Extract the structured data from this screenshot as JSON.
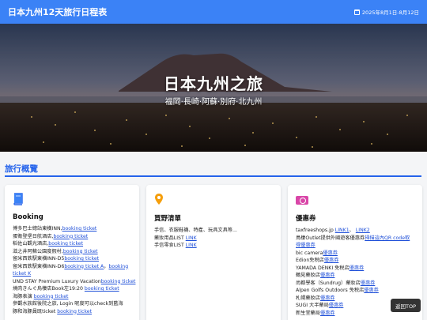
{
  "header": {
    "title": "日本九州12天旅行日程表",
    "date_range": "2025年8月1日-8月12日",
    "calendar_icon": "calendar-icon"
  },
  "hero": {
    "title": "日本九州之旅",
    "subtitle": "福岡·長崎·阿蘇·別府·北九州"
  },
  "section": {
    "title": "旅行概覽"
  },
  "cards": {
    "booking": {
      "icon": "book-icon",
      "title": "Booking",
      "lines": [
        {
          "text": "博多巴士總站東橫INN,",
          "link": "booking ticket",
          "tail": ""
        },
        {
          "text": "蛋衛登堡日航酒店,",
          "link": "booking ticket",
          "tail": ""
        },
        {
          "text": "稻佐山觀光酒店,",
          "link": "booking ticket",
          "tail": ""
        },
        {
          "text": "滋之井阿蘇公園度假村,",
          "link": "booking ticket",
          "tail": ""
        },
        {
          "text": "留米西鉄駅東横INN-D5",
          "link": "booking ticket",
          "tail": ""
        },
        {
          "text": "留米西鉄駅東横INN-D6",
          "link": "booking ticket A",
          "tail": "，"
        },
        {
          "text": "",
          "link": "booking",
          "tail": ""
        },
        {
          "text": "",
          "link": "ticket K",
          "tail": ""
        },
        {
          "text": "UND STAY Premium Luxury Vacation",
          "link": "booking ticket",
          "tail": ""
        },
        {
          "text": "燒肉きんぐ烏棲店Book左19:20 ",
          "link": "booking ticket",
          "tail": ""
        },
        {
          "text": "海豚表演 ",
          "link": "booking ticket",
          "tail": ""
        },
        {
          "text": "參觀水族館後院之旅, Login 呢度可以check到藍海",
          "link": "",
          "tail": ""
        },
        {
          "text": "豚和海豚員既ticket ",
          "link": "booking ticket",
          "tail": ""
        }
      ]
    },
    "shopping": {
      "icon": "map-pin-icon",
      "title": "買野清單",
      "lines": [
        {
          "text": "手信、衣服鞋襪、特產、玩具文具等...",
          "link": "",
          "tail": ""
        },
        {
          "text": "藥妝用品LIST ",
          "link": "LINK",
          "tail": ""
        },
        {
          "text": "手信零食LIST ",
          "link": "LINK",
          "tail": ""
        }
      ]
    },
    "coupons": {
      "icon": "money-icon",
      "title": "優惠券",
      "lines": [
        {
          "text": "taxfreeshops.jp",
          "link": "LINK1",
          "tail": "、",
          "link2": "LINK2"
        },
        {
          "text": "鳥棲Outlet提供外國遊客優惠券",
          "link": "掃描這內QR code取得優惠券",
          "tail": ""
        },
        {
          "text": "bic camera",
          "link": "優惠券",
          "tail": ""
        },
        {
          "text": "Edion免税店",
          "link": "優惠券",
          "tail": ""
        },
        {
          "text": "YAMADA DENKI 免税店",
          "link": "優惠券",
          "tail": ""
        },
        {
          "text": "鶴見藥妝店",
          "link": "優惠券",
          "tail": ""
        },
        {
          "text": "尚都學客（Sundrug）藥妝店",
          "link": "優惠券",
          "tail": ""
        },
        {
          "text": "Alpen Golfs Outdoors 免税店",
          "link": "優惠券",
          "tail": ""
        },
        {
          "text": "札幌藥妝店",
          "link": "優惠券",
          "tail": ""
        },
        {
          "text": "SUGI 大半藥局",
          "link": "優惠券",
          "tail": ""
        },
        {
          "text": "新生堂藥局",
          "link": "優惠券",
          "tail": ""
        }
      ]
    }
  },
  "back_to_top": "返回TOP"
}
